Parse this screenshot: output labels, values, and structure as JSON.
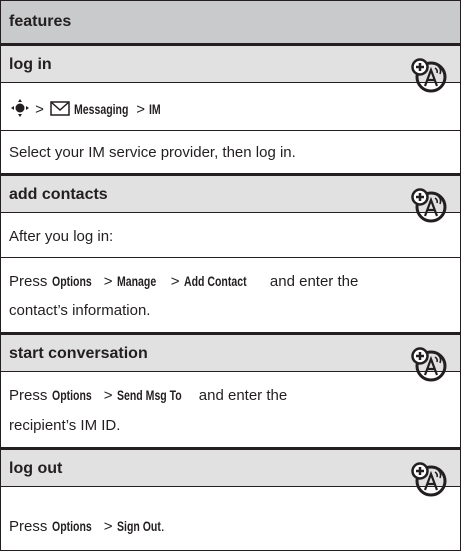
{
  "header": {
    "title": "features"
  },
  "sections": [
    {
      "title": "log in",
      "nav": {
        "gt1": ">",
        "item1": "Messaging",
        "gt2": ">",
        "item2": "IM"
      },
      "body": "Select your IM service provider, then log in."
    },
    {
      "title": "add contacts",
      "line1": "After you log in:",
      "press": "Press",
      "cmd1": "Options",
      "cmd2": "Manage",
      "cmd3": "Add Contact",
      "tail": "and enter the",
      "line3": "contact’s information."
    },
    {
      "title": "start conversation",
      "press": "Press",
      "cmd1": "Options",
      "cmd2": "Send Msg To",
      "tail": "and enter the",
      "line2": "recipient’s IM ID."
    },
    {
      "title": "log out",
      "press": "Press",
      "cmd1": "Options",
      "cmd2": "Sign Out",
      "end": "."
    }
  ],
  "gt": ">",
  "icons": {
    "network_feature": "network-feature-icon",
    "nav_key": "nav-key-icon",
    "envelope": "envelope-icon"
  },
  "colors": {
    "header_bg": "#c9cacb",
    "section_head_bg": "#e1e1e2",
    "text": "#231f20"
  }
}
